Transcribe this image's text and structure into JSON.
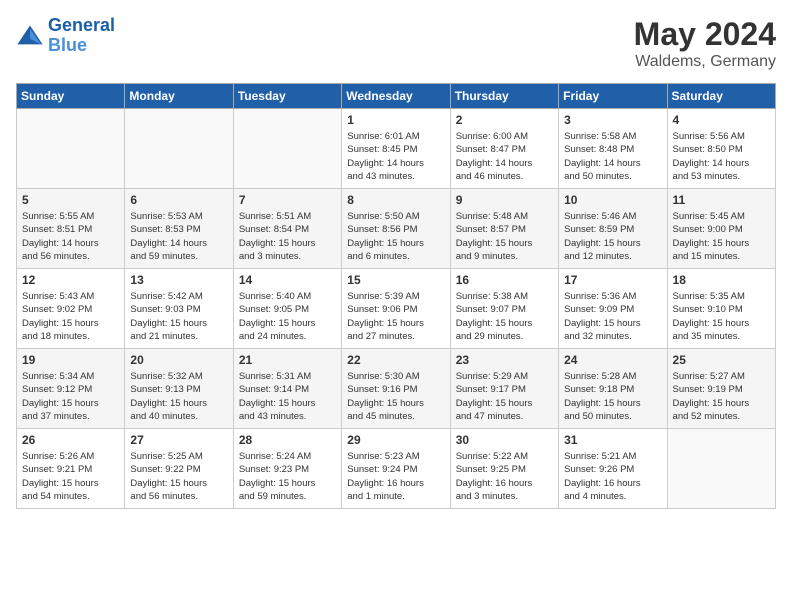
{
  "header": {
    "logo_line1": "General",
    "logo_line2": "Blue",
    "month_year": "May 2024",
    "location": "Waldems, Germany"
  },
  "weekdays": [
    "Sunday",
    "Monday",
    "Tuesday",
    "Wednesday",
    "Thursday",
    "Friday",
    "Saturday"
  ],
  "weeks": [
    [
      {
        "day": "",
        "info": ""
      },
      {
        "day": "",
        "info": ""
      },
      {
        "day": "",
        "info": ""
      },
      {
        "day": "1",
        "info": "Sunrise: 6:01 AM\nSunset: 8:45 PM\nDaylight: 14 hours\nand 43 minutes."
      },
      {
        "day": "2",
        "info": "Sunrise: 6:00 AM\nSunset: 8:47 PM\nDaylight: 14 hours\nand 46 minutes."
      },
      {
        "day": "3",
        "info": "Sunrise: 5:58 AM\nSunset: 8:48 PM\nDaylight: 14 hours\nand 50 minutes."
      },
      {
        "day": "4",
        "info": "Sunrise: 5:56 AM\nSunset: 8:50 PM\nDaylight: 14 hours\nand 53 minutes."
      }
    ],
    [
      {
        "day": "5",
        "info": "Sunrise: 5:55 AM\nSunset: 8:51 PM\nDaylight: 14 hours\nand 56 minutes."
      },
      {
        "day": "6",
        "info": "Sunrise: 5:53 AM\nSunset: 8:53 PM\nDaylight: 14 hours\nand 59 minutes."
      },
      {
        "day": "7",
        "info": "Sunrise: 5:51 AM\nSunset: 8:54 PM\nDaylight: 15 hours\nand 3 minutes."
      },
      {
        "day": "8",
        "info": "Sunrise: 5:50 AM\nSunset: 8:56 PM\nDaylight: 15 hours\nand 6 minutes."
      },
      {
        "day": "9",
        "info": "Sunrise: 5:48 AM\nSunset: 8:57 PM\nDaylight: 15 hours\nand 9 minutes."
      },
      {
        "day": "10",
        "info": "Sunrise: 5:46 AM\nSunset: 8:59 PM\nDaylight: 15 hours\nand 12 minutes."
      },
      {
        "day": "11",
        "info": "Sunrise: 5:45 AM\nSunset: 9:00 PM\nDaylight: 15 hours\nand 15 minutes."
      }
    ],
    [
      {
        "day": "12",
        "info": "Sunrise: 5:43 AM\nSunset: 9:02 PM\nDaylight: 15 hours\nand 18 minutes."
      },
      {
        "day": "13",
        "info": "Sunrise: 5:42 AM\nSunset: 9:03 PM\nDaylight: 15 hours\nand 21 minutes."
      },
      {
        "day": "14",
        "info": "Sunrise: 5:40 AM\nSunset: 9:05 PM\nDaylight: 15 hours\nand 24 minutes."
      },
      {
        "day": "15",
        "info": "Sunrise: 5:39 AM\nSunset: 9:06 PM\nDaylight: 15 hours\nand 27 minutes."
      },
      {
        "day": "16",
        "info": "Sunrise: 5:38 AM\nSunset: 9:07 PM\nDaylight: 15 hours\nand 29 minutes."
      },
      {
        "day": "17",
        "info": "Sunrise: 5:36 AM\nSunset: 9:09 PM\nDaylight: 15 hours\nand 32 minutes."
      },
      {
        "day": "18",
        "info": "Sunrise: 5:35 AM\nSunset: 9:10 PM\nDaylight: 15 hours\nand 35 minutes."
      }
    ],
    [
      {
        "day": "19",
        "info": "Sunrise: 5:34 AM\nSunset: 9:12 PM\nDaylight: 15 hours\nand 37 minutes."
      },
      {
        "day": "20",
        "info": "Sunrise: 5:32 AM\nSunset: 9:13 PM\nDaylight: 15 hours\nand 40 minutes."
      },
      {
        "day": "21",
        "info": "Sunrise: 5:31 AM\nSunset: 9:14 PM\nDaylight: 15 hours\nand 43 minutes."
      },
      {
        "day": "22",
        "info": "Sunrise: 5:30 AM\nSunset: 9:16 PM\nDaylight: 15 hours\nand 45 minutes."
      },
      {
        "day": "23",
        "info": "Sunrise: 5:29 AM\nSunset: 9:17 PM\nDaylight: 15 hours\nand 47 minutes."
      },
      {
        "day": "24",
        "info": "Sunrise: 5:28 AM\nSunset: 9:18 PM\nDaylight: 15 hours\nand 50 minutes."
      },
      {
        "day": "25",
        "info": "Sunrise: 5:27 AM\nSunset: 9:19 PM\nDaylight: 15 hours\nand 52 minutes."
      }
    ],
    [
      {
        "day": "26",
        "info": "Sunrise: 5:26 AM\nSunset: 9:21 PM\nDaylight: 15 hours\nand 54 minutes."
      },
      {
        "day": "27",
        "info": "Sunrise: 5:25 AM\nSunset: 9:22 PM\nDaylight: 15 hours\nand 56 minutes."
      },
      {
        "day": "28",
        "info": "Sunrise: 5:24 AM\nSunset: 9:23 PM\nDaylight: 15 hours\nand 59 minutes."
      },
      {
        "day": "29",
        "info": "Sunrise: 5:23 AM\nSunset: 9:24 PM\nDaylight: 16 hours\nand 1 minute."
      },
      {
        "day": "30",
        "info": "Sunrise: 5:22 AM\nSunset: 9:25 PM\nDaylight: 16 hours\nand 3 minutes."
      },
      {
        "day": "31",
        "info": "Sunrise: 5:21 AM\nSunset: 9:26 PM\nDaylight: 16 hours\nand 4 minutes."
      },
      {
        "day": "",
        "info": ""
      }
    ]
  ]
}
